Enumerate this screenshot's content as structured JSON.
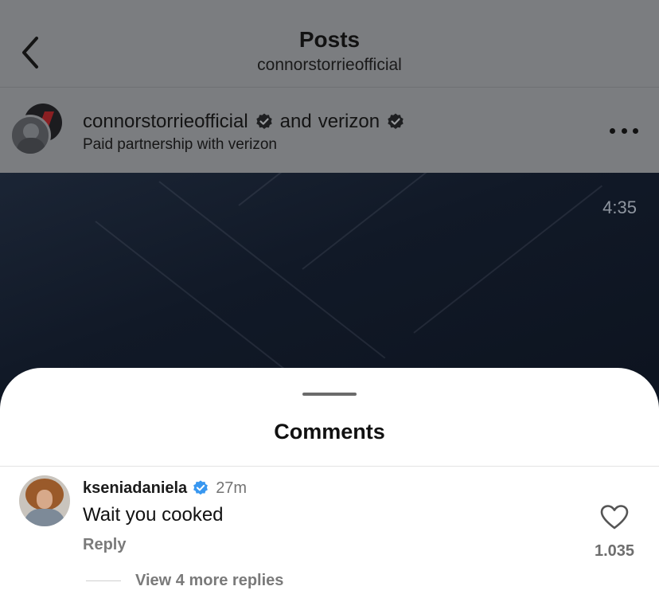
{
  "header": {
    "title": "Posts",
    "subtitle": "connorstorrieofficial"
  },
  "post": {
    "owner": "connorstorrieofficial",
    "joiner": "and",
    "collaborator": "verizon",
    "partnership_prefix": "Paid partnership with",
    "partnership_brand": "verizon",
    "video_time": "4:35"
  },
  "comments_sheet": {
    "title": "Comments",
    "comments": [
      {
        "username": "kseniadaniela",
        "verified": true,
        "time": "27m",
        "text": "Wait you cooked",
        "reply_label": "Reply",
        "likes": "1.035",
        "view_replies": "View 4 more replies"
      }
    ]
  },
  "colors": {
    "verified_blue": "#3897f0",
    "dim_overlay": "#7b7d80"
  },
  "icons": {
    "back": "chevron-left-icon",
    "more": "more-horizontal-icon",
    "verified": "verified-badge-icon",
    "like": "heart-outline-icon"
  }
}
